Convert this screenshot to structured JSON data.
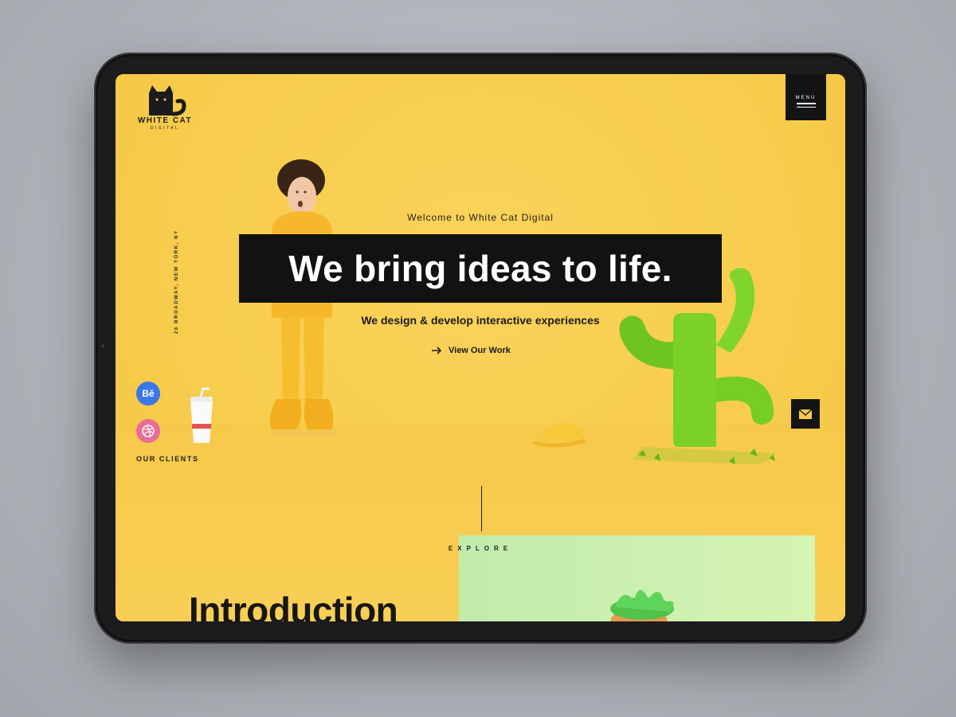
{
  "brand": {
    "name": "WHITE CAT",
    "sub": "DIGITAL"
  },
  "menu": {
    "label": "MENU"
  },
  "address": "26 BROADWAY, NEW YORK, NY",
  "social": {
    "behance": "Bē",
    "clients_label": "OUR CLIENTS"
  },
  "hero": {
    "welcome": "Welcome to White Cat Digital",
    "headline": "We bring ideas to life.",
    "subline": "We design & develop interactive experiences",
    "cta": "View Our Work"
  },
  "explore": "EXPLORE",
  "intro": "Introduction",
  "colors": {
    "background": "#f8cd4e",
    "dark": "#141414",
    "accent_green": "#6fcf2e",
    "panel_green": "#c8efb0"
  },
  "icons": [
    "cat-logo-icon",
    "menu-icon",
    "behance-icon",
    "dribbble-icon",
    "arrow-right-icon",
    "mail-icon"
  ]
}
